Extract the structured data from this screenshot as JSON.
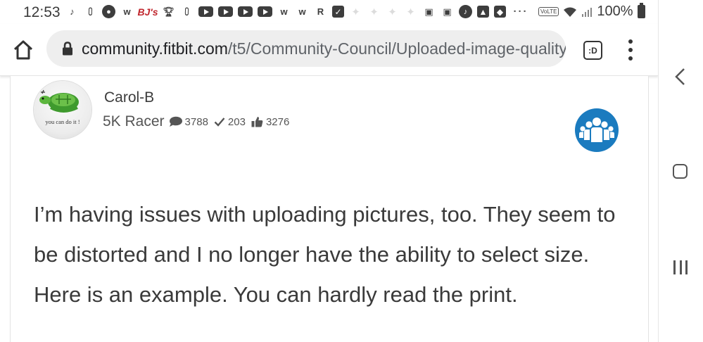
{
  "status_bar": {
    "time": "12:53",
    "notification_icons": [
      "tiktok-icon",
      "ifttt-icon",
      "chrome-icon",
      "walmart-icon",
      "bjs-icon",
      "trophy-icon",
      "ifttt-icon",
      "youtube-icon",
      "youtube-icon",
      "youtube-icon",
      "youtube-icon",
      "walmart-icon",
      "walmart-icon",
      "r-icon",
      "check-box-icon",
      "twitter-icon",
      "twitter-icon",
      "twitter-icon",
      "twitter-icon",
      "google-news-icon",
      "google-news-icon",
      "music-icon",
      "gallery-icon",
      "shopping-bag-icon",
      "more-dots-icon"
    ],
    "bjs_label": "BJ's",
    "volte_label": "VoLTE",
    "battery": "100%"
  },
  "browser": {
    "url_host": "community.fitbit.com",
    "url_path": "/t5/Community-Council/Uploaded-image-quality-",
    "tab_button_label": ":D"
  },
  "post": {
    "avatar_caption": "you can do it !",
    "author": "Carol-B",
    "rank": "5K Racer",
    "posts_count": "3788",
    "solutions_count": "203",
    "kudos_count": "3276",
    "body": "I’m having issues with uploading pictures, too. They seem to be distorted and I no longer have the ability to select size. Here is an example. You can hardly read the print."
  },
  "colors": {
    "badge_blue": "#1b7bbf",
    "bjs_red": "#c0262d"
  }
}
